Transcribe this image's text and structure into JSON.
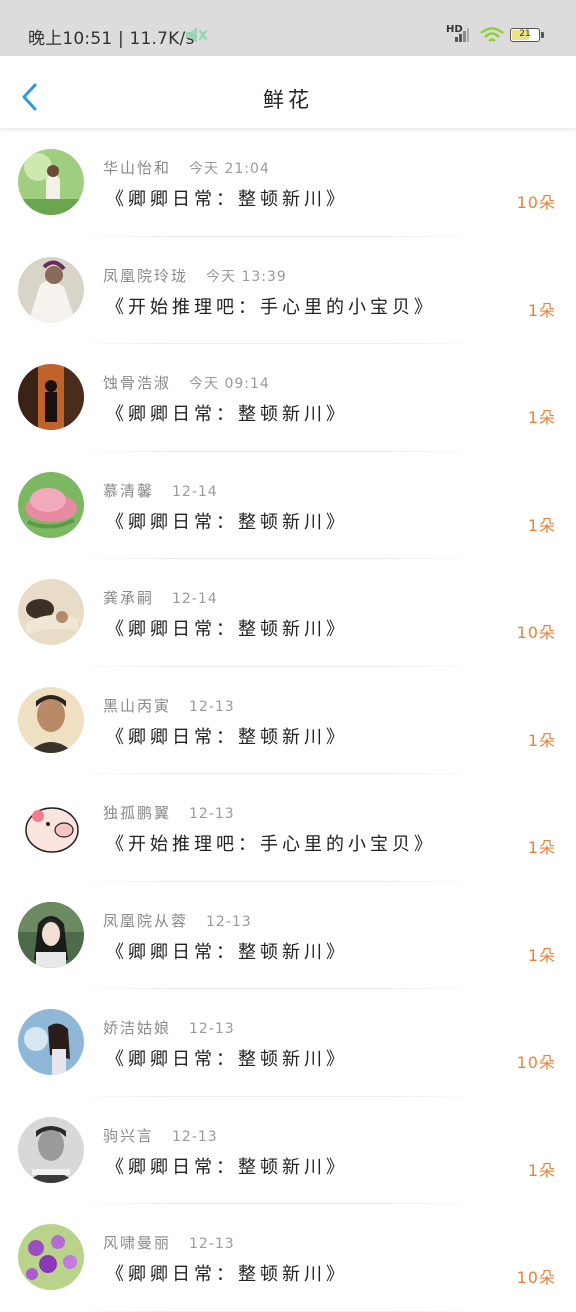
{
  "status_bar": {
    "time_speed": "晚上10:51 | 11.7K/s",
    "network_label": "HD",
    "battery_level": "21"
  },
  "header": {
    "back_icon": "chevron-left-icon",
    "title": "鲜花"
  },
  "colors": {
    "accent": "#2a9ae0",
    "count_color": "#e8833a",
    "status_bar_bg": "#dcdcdc"
  },
  "items": [
    {
      "name": "华山怡和",
      "time": "今天 21:04",
      "book": "《卿卿日常：整顿新川》",
      "count": "10朵",
      "avatar": "avatar-green-garden"
    },
    {
      "name": "凤凰院玲珑",
      "time": "今天 13:39",
      "book": "《开始推理吧：手心里的小宝贝》",
      "count": "1朵",
      "avatar": "avatar-white-robe"
    },
    {
      "name": "蚀骨浩淑",
      "time": "今天 09:14",
      "book": "《卿卿日常：整顿新川》",
      "count": "1朵",
      "avatar": "avatar-dark-silhouette"
    },
    {
      "name": "慕清馨",
      "time": "12-14",
      "book": "《卿卿日常：整顿新川》",
      "count": "1朵",
      "avatar": "avatar-pink-lotus"
    },
    {
      "name": "龚承嗣",
      "time": "12-14",
      "book": "《卿卿日常：整顿新川》",
      "count": "10朵",
      "avatar": "avatar-reclining-figure"
    },
    {
      "name": "黑山丙寅",
      "time": "12-13",
      "book": "《卿卿日常：整顿新川》",
      "count": "1朵",
      "avatar": "avatar-man-portrait"
    },
    {
      "name": "独孤鹏翼",
      "time": "12-13",
      "book": "《开始推理吧：手心里的小宝贝》",
      "count": "1朵",
      "avatar": "avatar-cartoon-pig"
    },
    {
      "name": "凤凰院从蓉",
      "time": "12-13",
      "book": "《卿卿日常：整顿新川》",
      "count": "1朵",
      "avatar": "avatar-woman-forest"
    },
    {
      "name": "娇洁姑娘",
      "time": "12-13",
      "book": "《卿卿日常：整顿新川》",
      "count": "10朵",
      "avatar": "avatar-woman-blue-sky"
    },
    {
      "name": "驹兴言",
      "time": "12-13",
      "book": "《卿卿日常：整顿新川》",
      "count": "1朵",
      "avatar": "avatar-bw-man"
    },
    {
      "name": "风啸曼丽",
      "time": "12-13",
      "book": "《卿卿日常：整顿新川》",
      "count": "10朵",
      "avatar": "avatar-purple-flowers"
    }
  ]
}
